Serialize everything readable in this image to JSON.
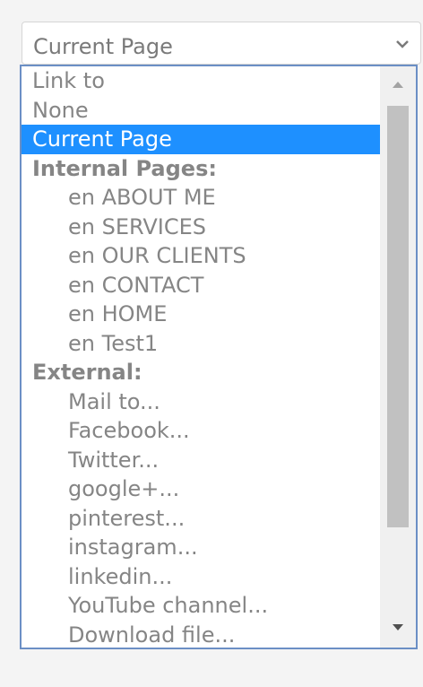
{
  "select": {
    "value": "Current Page",
    "icon": "chevron-down-icon"
  },
  "dropdown": {
    "options": [
      {
        "label": "Link to",
        "type": "option"
      },
      {
        "label": "None",
        "type": "option"
      },
      {
        "label": "Current Page",
        "type": "option",
        "selected": true
      },
      {
        "label": "Internal Pages:",
        "type": "group"
      },
      {
        "label": "en ABOUT ME",
        "type": "option",
        "indent": true
      },
      {
        "label": "en SERVICES",
        "type": "option",
        "indent": true
      },
      {
        "label": "en OUR CLIENTS",
        "type": "option",
        "indent": true
      },
      {
        "label": "en CONTACT",
        "type": "option",
        "indent": true
      },
      {
        "label": "en HOME",
        "type": "option",
        "indent": true
      },
      {
        "label": "en Test1",
        "type": "option",
        "indent": true
      },
      {
        "label": "External:",
        "type": "group"
      },
      {
        "label": "Mail to...",
        "type": "option",
        "indent": true
      },
      {
        "label": "Facebook...",
        "type": "option",
        "indent": true
      },
      {
        "label": "Twitter...",
        "type": "option",
        "indent": true
      },
      {
        "label": "google+...",
        "type": "option",
        "indent": true
      },
      {
        "label": "pinterest...",
        "type": "option",
        "indent": true
      },
      {
        "label": "instagram...",
        "type": "option",
        "indent": true
      },
      {
        "label": "linkedin...",
        "type": "option",
        "indent": true
      },
      {
        "label": "YouTube channel...",
        "type": "option",
        "indent": true
      },
      {
        "label": "Download file...",
        "type": "option",
        "indent": true
      }
    ],
    "scrollbar": {
      "up_icon": "scroll-up-arrow-icon",
      "down_icon": "scroll-down-arrow-icon"
    }
  },
  "colors": {
    "selected_bg": "#1e90ff",
    "selected_text": "#ffffff",
    "option_text": "#858585",
    "dropdown_border": "#6b8fc5"
  }
}
